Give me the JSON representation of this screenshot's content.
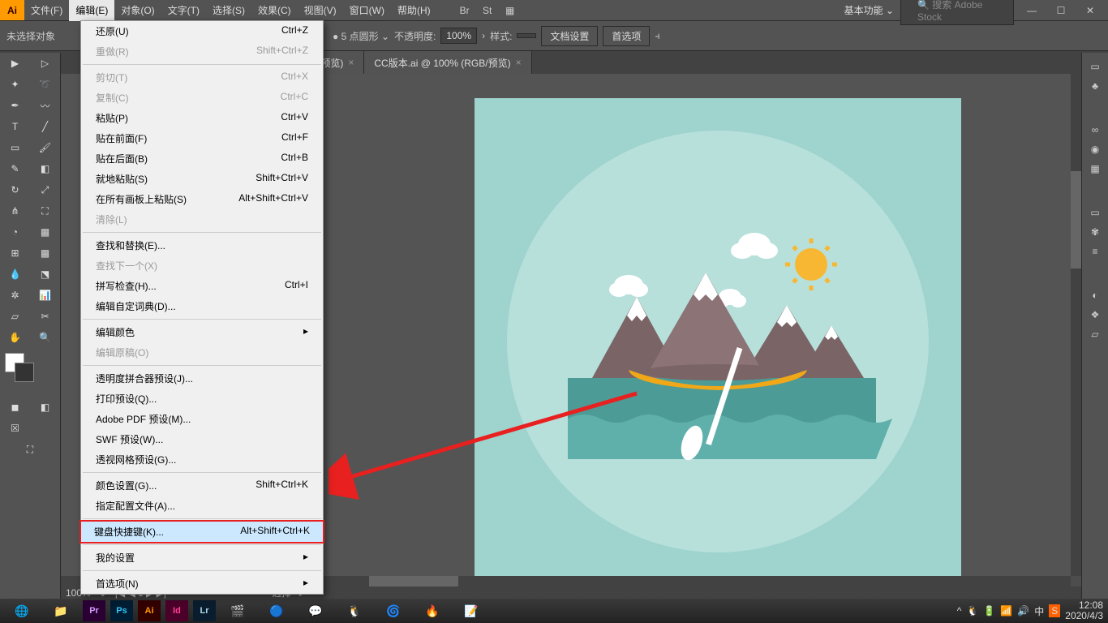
{
  "app": {
    "logo": "Ai"
  },
  "menu": {
    "file": "文件(F)",
    "edit": "编辑(E)",
    "object": "对象(O)",
    "type": "文字(T)",
    "select": "选择(S)",
    "effect": "效果(C)",
    "view": "视图(V)",
    "window": "窗口(W)",
    "help": "帮助(H)"
  },
  "workspace": "基本功能",
  "search_placeholder": "搜索 Adobe Stock",
  "controlbar": {
    "noselection": "未选择对象",
    "stroke_val": "5 点圆形",
    "opacity_label": "不透明度:",
    "opacity_val": "100%",
    "style_label": "样式:",
    "docsetup": "文档设置",
    "prefs": "首选项"
  },
  "tabs": {
    "t1": "RGB/像素预览)",
    "t2": "CC版本.ai @ 100% (RGB/预览)"
  },
  "dropdown": {
    "undo": "还原(U)",
    "undo_k": "Ctrl+Z",
    "redo": "重做(R)",
    "redo_k": "Shift+Ctrl+Z",
    "cut": "剪切(T)",
    "cut_k": "Ctrl+X",
    "copy": "复制(C)",
    "copy_k": "Ctrl+C",
    "paste": "粘贴(P)",
    "paste_k": "Ctrl+V",
    "pastefront": "贴在前面(F)",
    "pastefront_k": "Ctrl+F",
    "pasteback": "贴在后面(B)",
    "pasteback_k": "Ctrl+B",
    "pasteinplace": "就地粘贴(S)",
    "pasteinplace_k": "Shift+Ctrl+V",
    "pasteall": "在所有画板上粘贴(S)",
    "pasteall_k": "Alt+Shift+Ctrl+V",
    "clear": "清除(L)",
    "findreplace": "查找和替换(E)...",
    "findnext": "查找下一个(X)",
    "spellcheck": "拼写检查(H)...",
    "spellcheck_k": "Ctrl+I",
    "dict": "编辑自定词典(D)...",
    "editcolors": "编辑颜色",
    "editoriginal": "编辑原稿(O)",
    "transparency": "透明度拼合器预设(J)...",
    "printpreset": "打印预设(Q)...",
    "pdfpreset": "Adobe PDF 预设(M)...",
    "swfpreset": "SWF 预设(W)...",
    "gridpreset": "透视网格预设(G)...",
    "colorsettings": "颜色设置(G)...",
    "colorsettings_k": "Shift+Ctrl+K",
    "assignprofile": "指定配置文件(A)...",
    "kbshortcuts": "键盘快捷键(K)...",
    "kbshortcuts_k": "Alt+Shift+Ctrl+K",
    "mysettings": "我的设置",
    "preferences": "首选项(N)"
  },
  "status": {
    "zoom": "100%",
    "nav": "选择"
  },
  "taskbar": {
    "pr": "Pr",
    "ps": "Ps",
    "ai": "Ai",
    "id": "Id",
    "lr": "Lr",
    "time": "12:08",
    "date": "2020/4/3"
  }
}
